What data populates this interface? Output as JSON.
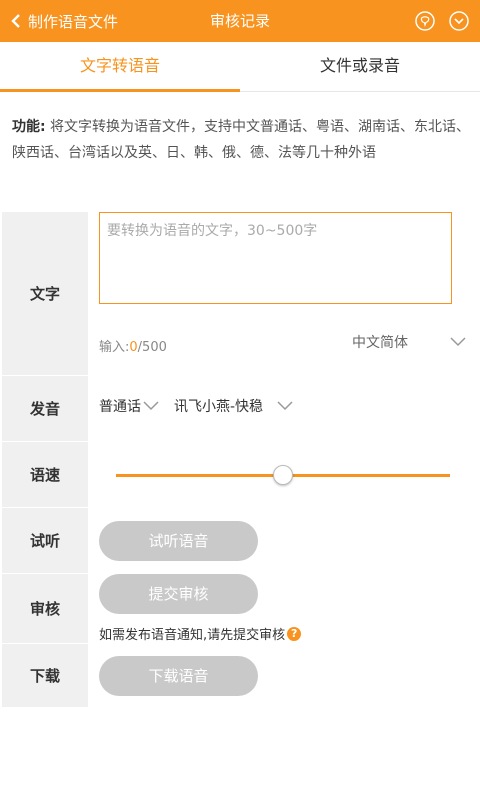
{
  "header": {
    "back_label": "制作语音文件",
    "title": "审核记录",
    "background": "#f7931e"
  },
  "tabs": [
    {
      "label": "文字转语音",
      "active": true
    },
    {
      "label": "文件或录音",
      "active": false
    }
  ],
  "description": {
    "lead": "功能:",
    "text": " 将文字转换为语音文件，支持中文普通话、粤语、湖南话、东北话、陕西话、台湾话以及英、日、韩、俄、德、法等几十种外语"
  },
  "form": {
    "text": {
      "label": "文字",
      "placeholder": "要转换为语音的文字，30~500字",
      "count_prefix": "输入:",
      "count_value": "0",
      "count_max": "/500",
      "language": "中文简体"
    },
    "voice": {
      "label": "发音",
      "dialect": "普通话",
      "speaker": "讯飞小燕-快稳"
    },
    "speed": {
      "label": "语速",
      "value": 0.5
    },
    "listen": {
      "label": "试听",
      "button": "试听语音"
    },
    "audit": {
      "label": "审核",
      "button": "提交审核",
      "hint": "如需发布语音通知,请先提交审核",
      "help_icon": "?"
    },
    "download": {
      "label": "下载",
      "button": "下载语音"
    }
  },
  "colors": {
    "accent": "#f7931e",
    "disabled_button": "#c9c9c9"
  }
}
